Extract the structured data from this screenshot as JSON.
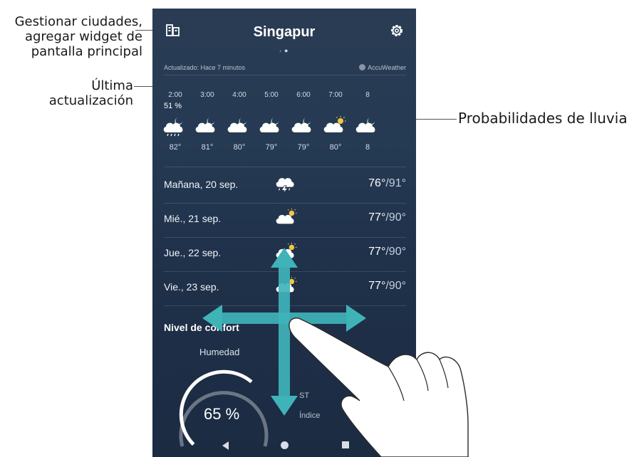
{
  "callouts": {
    "manage": "Gestionar ciudades, agregar widget de pantalla principal",
    "manage_lines": [
      "Gestionar ciudades,",
      "agregar widget de",
      "pantalla principal"
    ],
    "last_update_lines": [
      "Última",
      "actualización"
    ],
    "rain": "Probabilidades de lluvia"
  },
  "header": {
    "city": "Singapur",
    "manage_icon": "city-list-icon",
    "settings_icon": "gear-icon"
  },
  "status": {
    "updated": "Actualizado: Hace 7 minutos",
    "provider": "AccuWeather"
  },
  "hourly": {
    "rain_chance": "51 %",
    "hours": [
      {
        "time": "2:00",
        "temp": "82°",
        "icon": "rain-night-icon"
      },
      {
        "time": "3:00",
        "temp": "81°",
        "icon": "cloudy-night-icon"
      },
      {
        "time": "4:00",
        "temp": "80°",
        "icon": "cloudy-night-icon"
      },
      {
        "time": "5:00",
        "temp": "79°",
        "icon": "cloudy-night-icon"
      },
      {
        "time": "6:00",
        "temp": "79°",
        "icon": "cloudy-night-icon"
      },
      {
        "time": "7:00",
        "temp": "80°",
        "icon": "cloudy-day-icon"
      },
      {
        "time": "8",
        "temp": "8",
        "icon": "cloudy-night-icon"
      }
    ]
  },
  "daily": [
    {
      "label": "Mañana, 20 sep.",
      "low": "76°",
      "high": "/91°",
      "icon": "thunderstorm-icon"
    },
    {
      "label": "Mié., 21 sep.",
      "low": "77°",
      "high": "/90°",
      "icon": "partly-cloudy-icon"
    },
    {
      "label": "Jue., 22 sep.",
      "low": "77°",
      "high": "/90°",
      "icon": "partly-cloudy-icon"
    },
    {
      "label": "Vie., 23 sep.",
      "low": "77°",
      "high": "/90°",
      "icon": "partly-cloudy-icon"
    }
  ],
  "comfort": {
    "title": "Nivel de confort",
    "humidity_label": "Humedad",
    "humidity_value": "65 %",
    "humidity_fraction": 0.65,
    "st": "ST",
    "index_label": "Índice"
  },
  "colors": {
    "arrow": "#3fb3b8",
    "background_top": "#2a3c54",
    "background_bottom": "#1b2b42"
  }
}
